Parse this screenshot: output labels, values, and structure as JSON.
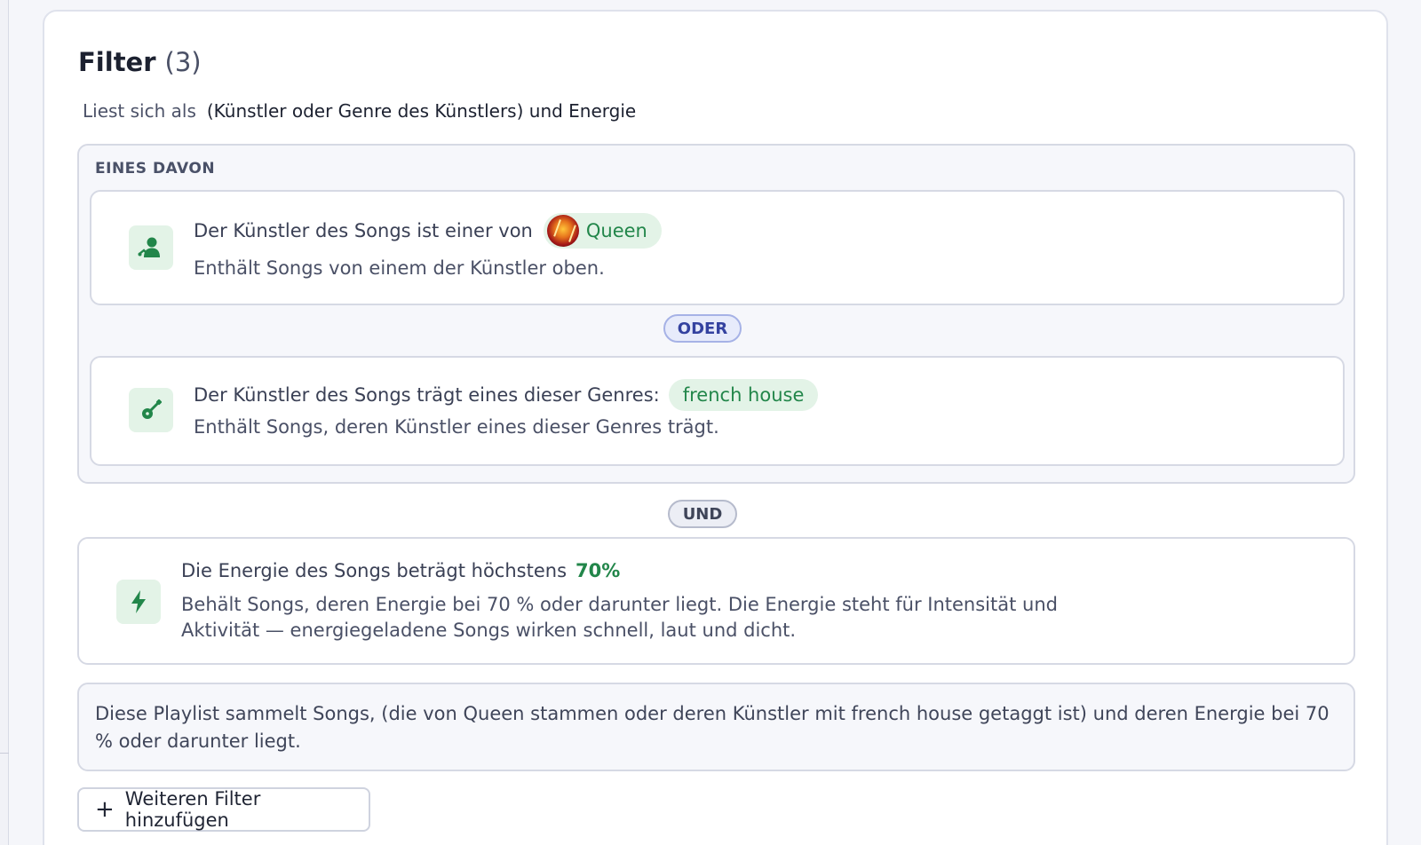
{
  "filter": {
    "title": "Filter",
    "count": "(3)",
    "reads_as_label": "Liest sich als",
    "reads_as_expression": "(Künstler oder Genre des Künstlers) und Energie"
  },
  "group": {
    "label": "EINES DAVON",
    "rules": [
      {
        "text": "Der Künstler des Songs ist einer von",
        "chip": "Queen",
        "description": "Enthält Songs von einem der Künstler oben.",
        "icon": "artist-icon"
      },
      {
        "text": "Der Künstler des Songs trägt eines dieser Genres:",
        "chip": "french house",
        "description": "Enthält Songs, deren Künstler eines dieser Genres trägt.",
        "icon": "guitar-icon"
      }
    ],
    "or_label": "ODER"
  },
  "and_label": "UND",
  "energy_rule": {
    "text": "Die Energie des Songs beträgt höchstens",
    "value": "70%",
    "description": "Behält Songs, deren Energie bei 70 % oder darunter liegt. Die Energie steht für Intensität und Aktivität — energiegeladene Songs wirken schnell, laut und dicht.",
    "icon": "lightning-icon"
  },
  "summary": "Diese Playlist sammelt Songs, (die von Queen stammen oder deren Künstler mit french house getaggt ist) und deren Energie bei 70 % oder darunter liegt.",
  "add_button": {
    "plus": "+",
    "label": "Weiteren Filter hinzufügen"
  },
  "colors": {
    "accent_green": "#22864a",
    "chip_bg": "#e3f3e7",
    "or_blue": "#3442a0"
  }
}
